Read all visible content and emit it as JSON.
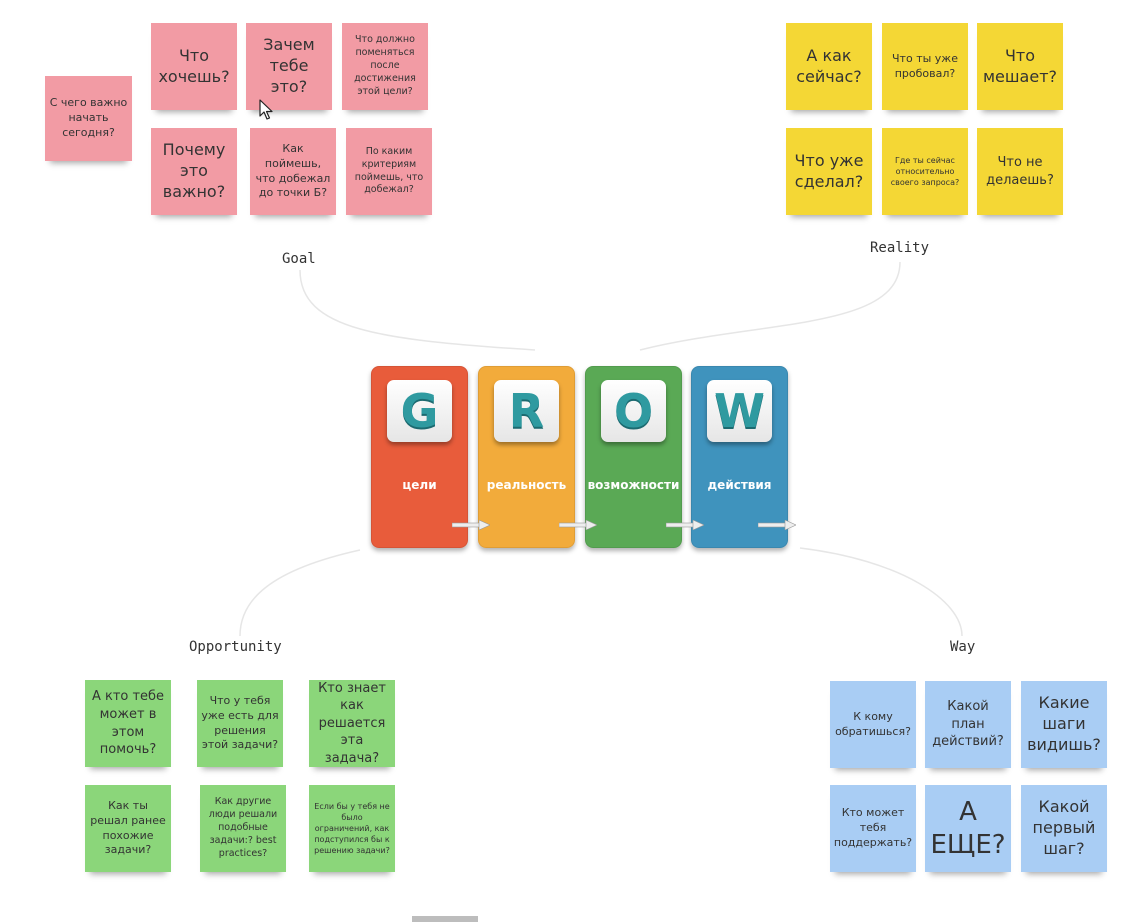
{
  "labels": {
    "goal": "Goal",
    "reality": "Reality",
    "opportunity": "Opportunity",
    "way": "Way"
  },
  "goal_notes": {
    "start": "С чего важно начать сегодня?",
    "want": "Что хочешь?",
    "why_need": "Зачем тебе это?",
    "change": "Что должно поменяться после достижения этой цели?",
    "why_important": "Почему это важно?",
    "point_b": "Как поймешь, что добежал до точки Б?",
    "criteria": "По каким критериям поймешь, что добежал?"
  },
  "reality_notes": {
    "now": "А как сейчас?",
    "tried": "Что ты уже пробовал?",
    "blocks": "Что мешает?",
    "done": "Что уже сделал?",
    "where": "Где ты сейчас относительно своего запроса?",
    "not_doing": "Что не делаешь?"
  },
  "opportunity_notes": {
    "who_help": "А кто тебе может в этом помочь?",
    "have": "Что у тебя уже есть для решения этой задачи?",
    "who_knows": "Кто знает как решается эта задача?",
    "solved_before": "Как ты решал ранее похожие задачи?",
    "others": "Как другие люди решали подобные задачи:? best practices?",
    "no_limits": "Если бы у тебя не было ограничений, как подступился бы к решению задачи?"
  },
  "way_notes": {
    "whom": "К кому обратишься?",
    "plan": "Какой план действий?",
    "steps": "Какие шаги видишь?",
    "support": "Кто может тебя поддержать?",
    "more": "А ЕЩЕ?",
    "first_step": "Какой первый шаг?"
  },
  "grow": {
    "g_letter": "G",
    "g_word": "цели",
    "g_color": "#e85c3b",
    "r_letter": "R",
    "r_word": "реальность",
    "r_color": "#f2ab3b",
    "o_letter": "O",
    "o_word": "возможности",
    "o_color": "#5aa955",
    "w_letter": "W",
    "w_word": "действия",
    "w_color": "#3f93bd"
  },
  "colors": {
    "pink": "#f29ba4",
    "yellow": "#f4d735",
    "green": "#8bd67a",
    "blue": "#a9cdf4"
  }
}
